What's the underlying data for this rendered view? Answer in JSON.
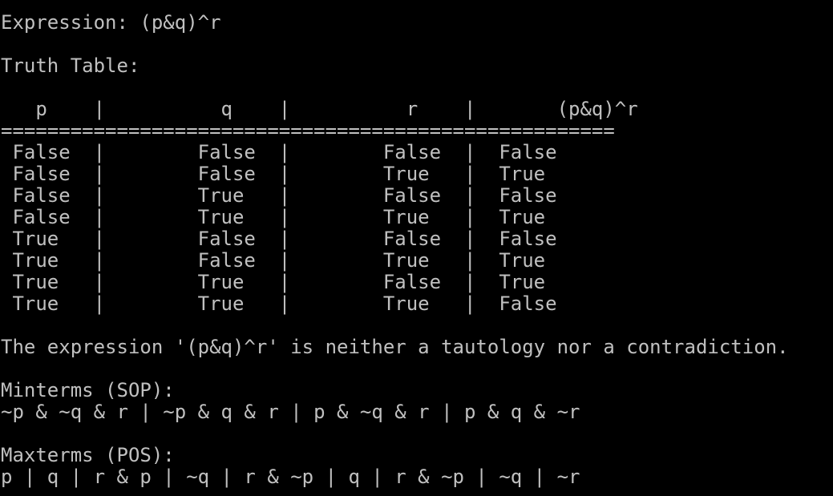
{
  "terminal": {
    "background_color": "#000000",
    "text_color": "#c0c0c0",
    "expression_line": "Expression: (p&q)^r",
    "truth_table_title": "Truth Table:",
    "table": {
      "header_line": "   p    |          q    |          r    |       (p&q)^r",
      "separator_line": "=====================================================",
      "rows": [
        " False  |        False  |        False  |  False",
        " False  |        False  |        True   |  True",
        " False  |        True   |        False  |  False",
        " False  |        True   |        True   |  True",
        " True   |        False  |        False  |  False",
        " True   |        False  |        True   |  True",
        " True   |        True   |        False  |  True",
        " True   |        True   |        True   |  False"
      ]
    },
    "result_line": "The expression '(p&q)^r' is neither a tautology nor a contradiction.",
    "minterms_title": "Minterms (SOP):",
    "minterms_line": "~p & ~q & r | ~p & q & r | p & ~q & r | p & q & ~r",
    "maxterms_title": "Maxterms (POS):",
    "maxterms_line": "p | q | r & p | ~q | r & ~p | q | r & ~p | ~q | ~r"
  }
}
